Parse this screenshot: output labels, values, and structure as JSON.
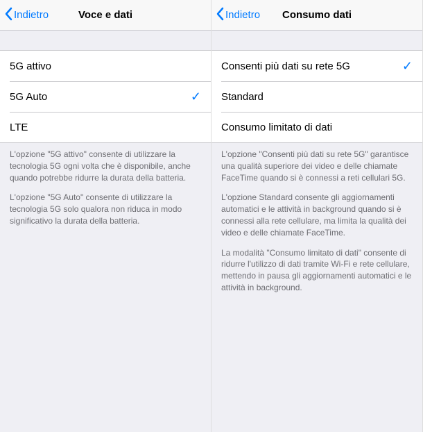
{
  "left": {
    "back_label": "Indietro",
    "title": "Voce e dati",
    "options": [
      {
        "label": "5G attivo",
        "selected": false
      },
      {
        "label": "5G Auto",
        "selected": true
      },
      {
        "label": "LTE",
        "selected": false
      }
    ],
    "footer_paragraphs": [
      "L'opzione \"5G attivo\" consente di utilizzare la tecnologia 5G ogni volta che è disponibile, anche quando potrebbe ridurre la durata della batteria.",
      "L'opzione \"5G Auto\" consente di utilizzare la tecnologia 5G solo qualora non riduca in modo significativo la durata della batteria."
    ]
  },
  "right": {
    "back_label": "Indietro",
    "title": "Consumo dati",
    "options": [
      {
        "label": "Consenti più dati su rete 5G",
        "selected": true
      },
      {
        "label": "Standard",
        "selected": false
      },
      {
        "label": "Consumo limitato di dati",
        "selected": false
      }
    ],
    "footer_paragraphs": [
      "L'opzione \"Consenti più dati su rete 5G\" garantisce una qualità superiore dei video e delle chiamate FaceTime quando si è connessi a reti cellulari 5G.",
      "L'opzione Standard consente gli aggiornamenti automatici e le attività in background quando si è connessi alla rete cellulare, ma limita la qualità dei video e delle chiamate FaceTime.",
      "La modalità \"Consumo limitato di dati\" consente di ridurre l'utilizzo di dati tramite Wi-Fi e rete cellulare, mettendo in pausa gli aggiornamenti automatici e le attività in background."
    ]
  },
  "checkmark_glyph": "✓"
}
